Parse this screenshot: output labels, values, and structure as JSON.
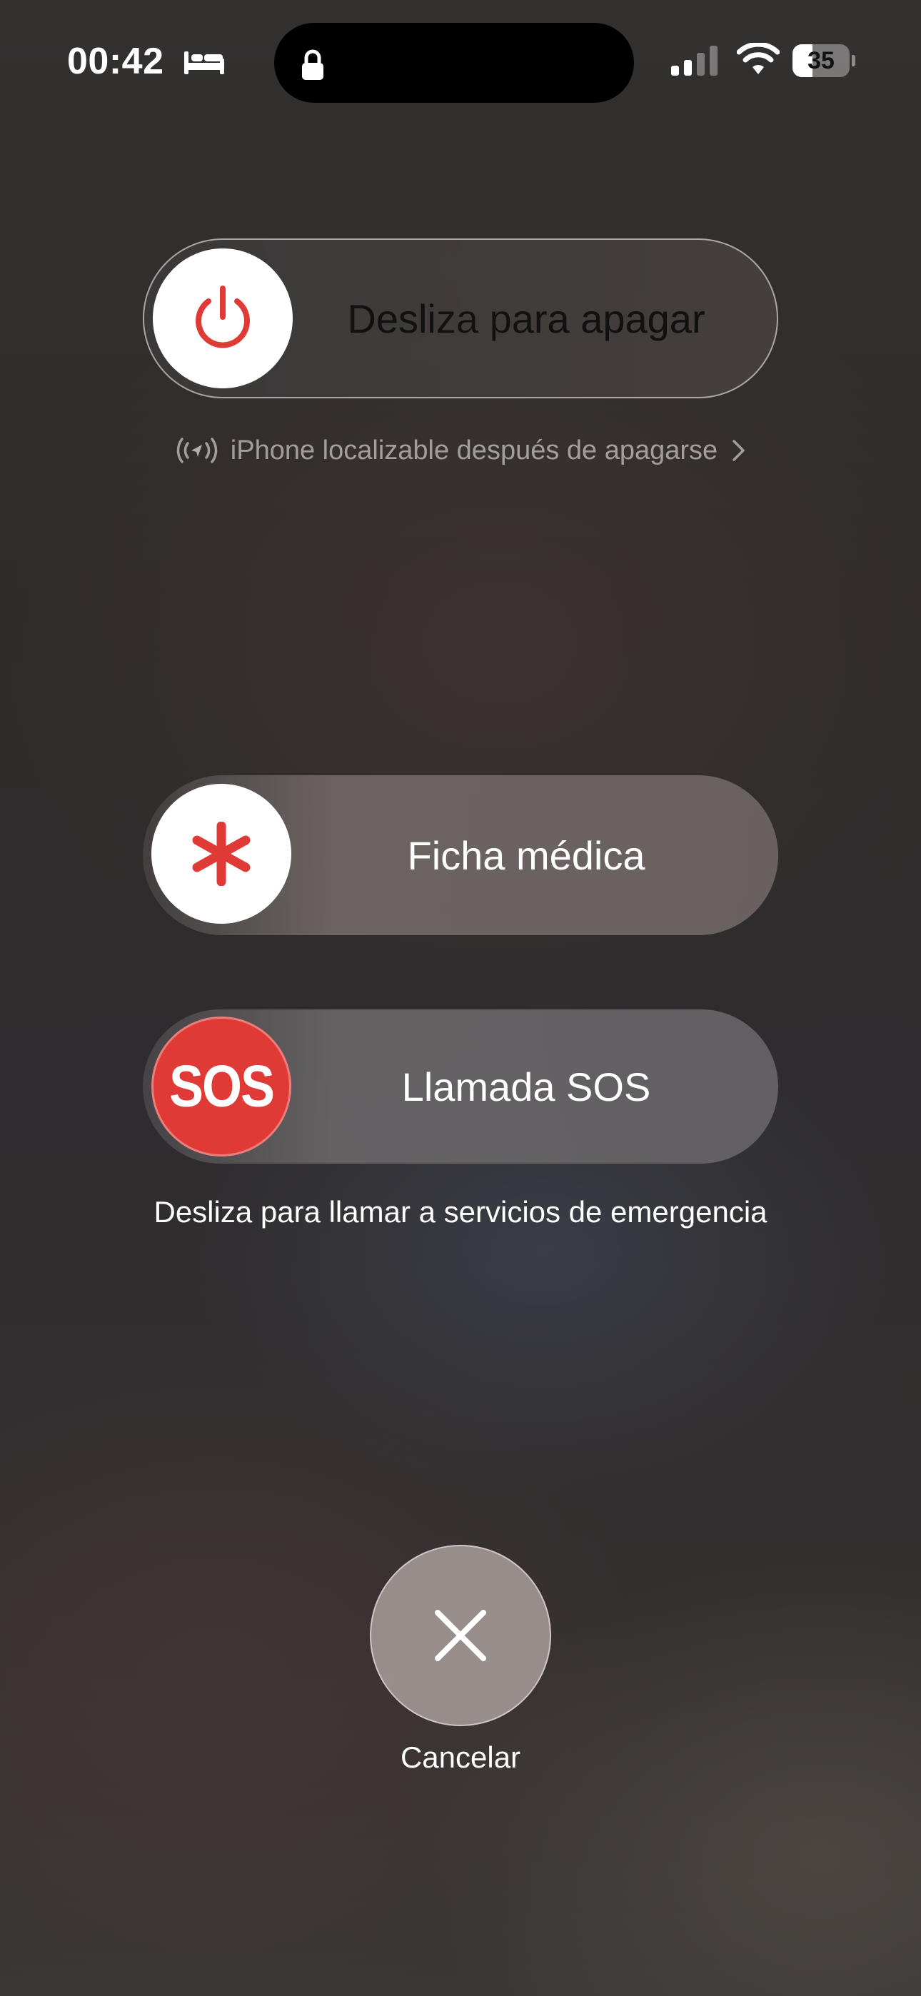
{
  "status_bar": {
    "time": "00:42",
    "focus_icon": "bed-icon",
    "lock_icon": "lock-icon",
    "signal_icon": "cellular-signal-icon",
    "wifi_icon": "wifi-icon",
    "battery_percent": "35",
    "battery_level": 0.35
  },
  "power_slider": {
    "label": "Desliza para apagar",
    "icon": "power-icon",
    "accent": "#e03a36"
  },
  "findmy": {
    "text": "iPhone localizable después de apagarse",
    "icon": "findmy-signal-icon",
    "chevron": "chevron-right-icon"
  },
  "medical_slider": {
    "label": "Ficha médica",
    "icon": "medical-asterisk-icon",
    "accent": "#e03a36"
  },
  "sos_slider": {
    "knob_text": "SOS",
    "label": "Llamada SOS",
    "accent": "#e03a36"
  },
  "sos_caption": "Desliza para llamar a servicios de emergencia",
  "cancel": {
    "label": "Cancelar",
    "icon": "close-icon"
  }
}
